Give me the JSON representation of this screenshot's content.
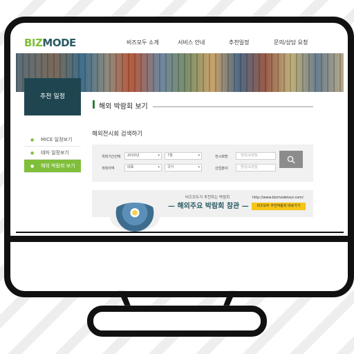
{
  "site": {
    "logo_biz": "BIZ",
    "logo_mode": "MODE",
    "nav": [
      "비즈모두 소개",
      "서비스 안내",
      "추천일정",
      "문의/상담 요청"
    ]
  },
  "sidebar": {
    "title": "추천 일정",
    "items": [
      {
        "label": "MICE 일정보기",
        "active": false
      },
      {
        "label": "테마 일정보기",
        "active": false
      },
      {
        "label": "해외 박람회 보기",
        "active": true
      }
    ]
  },
  "main": {
    "title": "해외 박람회 보기",
    "search_heading": "해외전시회 검색하기",
    "search": {
      "period_label": "개최기간선택",
      "year_value": "2020년",
      "month_value": "7월",
      "region_label": "개최지역",
      "continent_value": "대륙",
      "country_value": "국가",
      "exhibition_label": "전시회명",
      "exhibition_placeholder": "명칭/요명칭",
      "industry_label": "산업분야",
      "industry_placeholder": "명칭/요명칭"
    }
  },
  "banner": {
    "subtitle": "비즈모두가 추천하는 박람회",
    "title": "해외주요 박람회 참관",
    "url": "http://www.bizmodetour.com/",
    "button": "비즈모두 추천박람회 바로가기"
  },
  "colors": {
    "accent_green": "#7fbf3a",
    "dark_teal": "#1f4650",
    "banner_button": "#f5c518"
  }
}
